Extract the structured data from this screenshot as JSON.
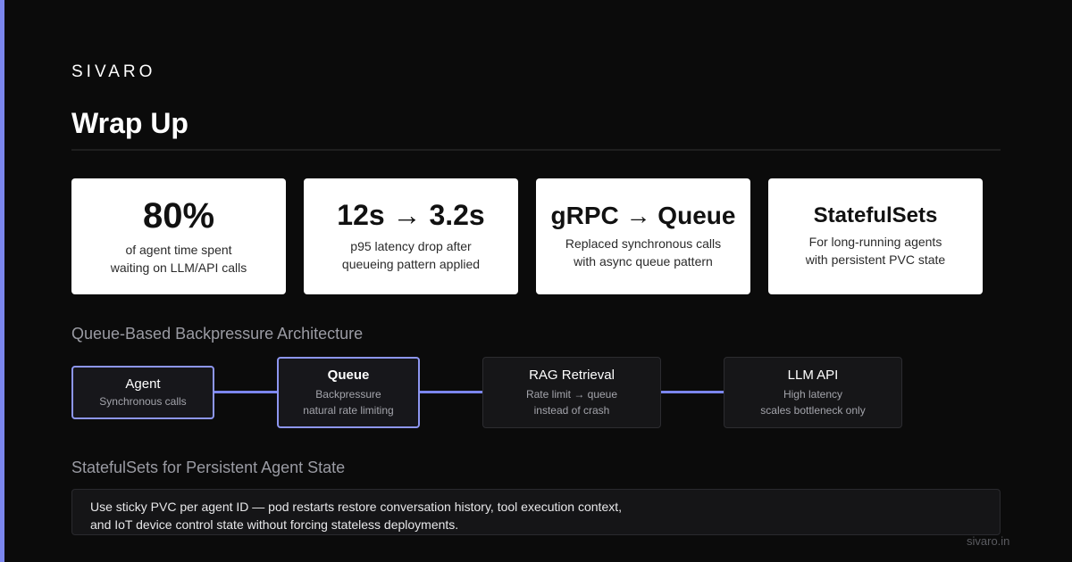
{
  "brand": "SIVARO",
  "title": "Wrap Up",
  "stats": [
    {
      "value": "80%",
      "desc1": "of agent time spent",
      "desc2": "waiting on LLM/API calls"
    },
    {
      "value": "12s → 3.2s",
      "desc1": "p95 latency drop after",
      "desc2": "queueing pattern applied"
    },
    {
      "value": "gRPC → Queue",
      "desc1": "Replaced synchronous calls",
      "desc2": "with async queue pattern"
    },
    {
      "value": "StatefulSets",
      "desc1": "For long-running agents",
      "desc2": "with persistent PVC state"
    }
  ],
  "architecture": {
    "heading": "Queue-Based Backpressure Architecture",
    "nodes": [
      {
        "title": "Agent",
        "sub1": "Synchronous calls",
        "sub2": ""
      },
      {
        "title": "Queue",
        "sub1": "Backpressure",
        "sub2": "natural rate limiting"
      },
      {
        "title": "RAG Retrieval",
        "sub1": "Rate limit → queue",
        "sub2": "instead of crash"
      },
      {
        "title": "LLM API",
        "sub1": "High latency",
        "sub2": "scales bottleneck only"
      }
    ]
  },
  "statefulsets": {
    "heading": "StatefulSets for Persistent Agent State",
    "line1": "Use sticky PVC per agent ID — pod restarts restore conversation history, tool execution context,",
    "line2": "and IoT device control state without forcing stateless deployments."
  },
  "footer": "sivaro.in",
  "colors": {
    "accent": "#7b86ee",
    "background": "#0b0b0b",
    "card": "#ffffff"
  }
}
